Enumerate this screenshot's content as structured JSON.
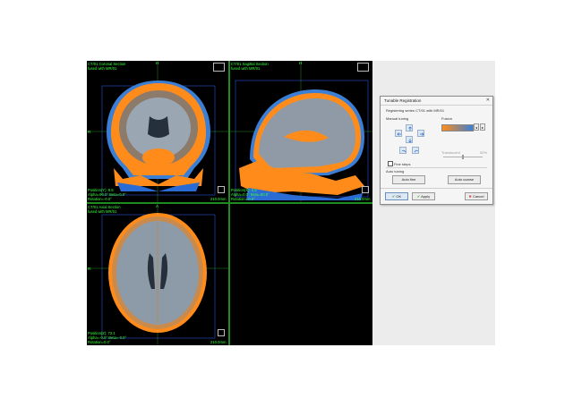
{
  "viewports": {
    "coronal": {
      "title": "CT/01 Coronal Section",
      "subtitle": "fused with MR/01",
      "orient_top": "H",
      "orient_left": "R",
      "position": "Position(Y): 8.8",
      "angles": "Alpha=90.0° Beta=0.0°",
      "rotation": "Rotation=-0.0°",
      "scale": "210.0mm"
    },
    "sagittal": {
      "title": "CT/01 Sagittal Section",
      "subtitle": "fused with MR/01",
      "orient_top": "H",
      "position": "Position(X): 4.5",
      "angles": "Alpha=0.0° Beta=90.0°",
      "rotation": "Rotation=-0.0°",
      "scale": "210.0mm"
    },
    "axial": {
      "title": "CT/01 Axial Section",
      "subtitle": "fused with MR/01",
      "orient_top": "A",
      "orient_left": "R",
      "position": "Position(Z): 72.1",
      "angles": "Alpha=-0.0° Beta=-0.0°",
      "rotation": "Rotation=0.0°",
      "scale": "210.0mm"
    }
  },
  "dialog": {
    "title": "Tunable Registration",
    "close": "✕",
    "subtitle": "Registering series CT/01 with MR/01",
    "manual_tuning_label": "Manual tuning",
    "fusion_label": "Fusion",
    "fine_steps_label": "Fine steps",
    "translucent_label": "Translucent",
    "translucent_value": "50%",
    "auto_tuning_label": "Auto tuning",
    "auto_fine_label": "Auto fine",
    "auto_coarse_label": "Auto coarse",
    "ok_label": "OK",
    "apply_label": "Apply",
    "cancel_label": "Cancel"
  },
  "colors": {
    "overlay_text": "#3cff3c",
    "grid_line": "#1e8c1e",
    "fusion_orange": "#ff8c1a",
    "fusion_blue": "#3a7fd5"
  }
}
